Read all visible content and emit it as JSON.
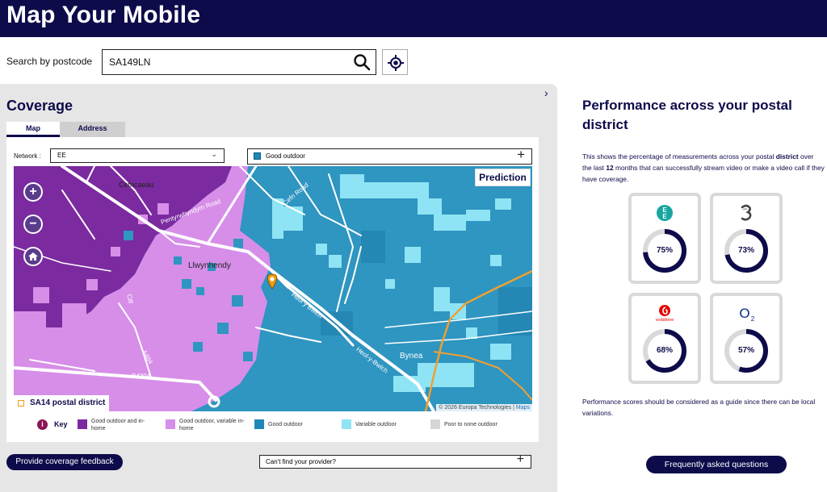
{
  "header": {
    "title": "Map Your Mobile"
  },
  "search": {
    "label": "Search by postcode",
    "value": "SA149LN"
  },
  "coverage": {
    "title": "Coverage",
    "tabs": [
      {
        "label": "Map"
      },
      {
        "label": "Address"
      }
    ],
    "network": {
      "label": "Network :",
      "value": "EE"
    },
    "layer": {
      "value": "Good outdoor",
      "color": "#1d88b8"
    },
    "map": {
      "badge": "Prediction",
      "district": "SA14 postal district",
      "attribution_prefix": "© 2026 Europa Technologies | ",
      "attribution_link": "Maps",
      "labels": [
        "Cefncaeau",
        "Pentyrwhyndym Road",
        "Llwynhendy",
        "Bynea",
        "Cefn Road",
        "Heol y Bwlch",
        "Heol-y-Bwlch",
        "A484",
        "B4304",
        "Cilf"
      ]
    },
    "key_label": "Key",
    "legend": [
      {
        "label": "Good outdoor and in-home",
        "color": "#7b2aa0"
      },
      {
        "label": "Good outdoor, variable in-home",
        "color": "#d68ee8"
      },
      {
        "label": "Good outdoor",
        "color": "#1d88b8"
      },
      {
        "label": "Variable outdoor",
        "color": "#8ee4f4"
      },
      {
        "label": "Poor to none outdoor",
        "color": "#d6d6d6"
      }
    ],
    "feedback_button": "Provide coverage feedback",
    "provider_prompt": "Can't find your provider?"
  },
  "performance": {
    "title": "Performance across your postal district",
    "description_parts": [
      "This shows the percentage of measurements across your postal ",
      "district",
      " over the last ",
      "12",
      " months that can successfully stream video or make a video call if they have coverage."
    ],
    "operators": [
      {
        "name": "EE",
        "percent": 75,
        "label": "75%",
        "logo_color": "#18a6a2"
      },
      {
        "name": "Three",
        "percent": 73,
        "label": "73%",
        "logo_color": "#333333"
      },
      {
        "name": "vodafone",
        "percent": 68,
        "label": "68%",
        "logo_color": "#e60000"
      },
      {
        "name": "O2",
        "percent": 57,
        "label": "57%",
        "logo_color": "#0a2a8a"
      }
    ],
    "note": "Performance scores should be considered as a guide since there can be local variations.",
    "faq_button": "Frequently asked questions"
  }
}
